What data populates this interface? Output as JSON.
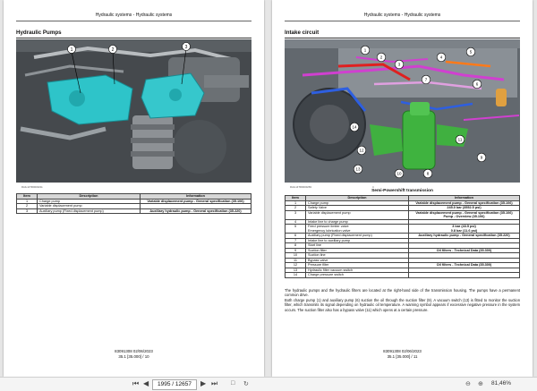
{
  "left_page": {
    "header": "Hydraulic systems - Hydraulic systems",
    "section_title": "Hydraulic Pumps",
    "figure_id": "RAIL14TR0000211",
    "figure_callouts": [
      "1",
      "2",
      "3"
    ],
    "table": {
      "headers": [
        "Item",
        "Description",
        "Information"
      ],
      "rows": [
        [
          "1",
          "Charge pump",
          "Variable displacement pump - General specification (35.106)"
        ],
        [
          "2",
          "Variable displacement pump",
          ""
        ],
        [
          "3",
          "Auxiliary pump (Fixed displacement pump)",
          "Auxiliary hydraulic pump - General specification (35.220)"
        ]
      ]
    },
    "footer_doc": "83091308 02/06/2023",
    "footer_page": "35.1 [35.000] / 10"
  },
  "right_page": {
    "header": "Hydraulic systems - Hydraulic systems",
    "section_title": "Intake circuit",
    "figure_id": "RAIL14TR0000283",
    "figure_number": "4",
    "figure_caption": "Semi-Powershift transmission",
    "figure_callouts": [
      "1",
      "2",
      "3",
      "4",
      "5",
      "6",
      "7",
      "8",
      "9",
      "10",
      "11",
      "12",
      "13",
      "14"
    ],
    "table": {
      "headers": [
        "Item",
        "Description",
        "Information"
      ],
      "rows": [
        [
          "1",
          "Charge pump",
          "Variable displacement pump - General specification (35.106)"
        ],
        [
          "2",
          "Safety Valve",
          "245.0 bar (3552.5 psi)"
        ],
        [
          "3",
          "Variable displacement pump",
          "Variable displacement pump - General specification (35.106)\nPump - Overview (35.106)"
        ],
        [
          "4",
          "Intake line to charge pump",
          ""
        ],
        [
          "5",
          "Feed pressure limiter valve\nEmergency lubrication valve",
          "3 bar (43.5 psi)\n0.8 bar (11.6 psi)"
        ],
        [
          "6",
          "Auxiliary pump (Fixed displacement pump)",
          "Auxiliary hydraulic pump - General specification (35.220)"
        ],
        [
          "7",
          "Intake line to auxiliary pump",
          ""
        ],
        [
          "8",
          "Start line",
          ""
        ],
        [
          "9",
          "Suction filter",
          "Oil filters - Technical Data (35.300)"
        ],
        [
          "10",
          "Suction line",
          ""
        ],
        [
          "11",
          "Bypass valve",
          ""
        ],
        [
          "12",
          "Pressure filter",
          "Oil filters - Technical Data (35.300)"
        ],
        [
          "13",
          "Hydraulic filter vacuum switch",
          ""
        ],
        [
          "14",
          "Charge pressure switch",
          ""
        ]
      ]
    },
    "body": "The hydraulic pumps and the hydraulic filters are located at the right-hand side of the transmission housing. The pumps have a permanent common drive.\nBoth charge pump (1) and auxiliary pump (6) suction the oil through the suction filter (9). A vacuum switch (13) is fitted to monitor the suction filter, which transmits its signal depending on hydraulic oil temperature. A warning symbol appears if excessive negative pressure in the system occurs. The suction filter also has a bypass valve (11) which opens at a certain pressure.",
    "footer_doc": "83091308 02/06/2023",
    "footer_page": "35.1 [35.000] / 11"
  },
  "toolbar": {
    "first_icon": "first-page-icon",
    "prev_icon": "prev-page-icon",
    "page_input": "1995 / 12657",
    "next_icon": "next-page-icon",
    "last_icon": "last-page-icon",
    "zoom": "81,46%"
  }
}
